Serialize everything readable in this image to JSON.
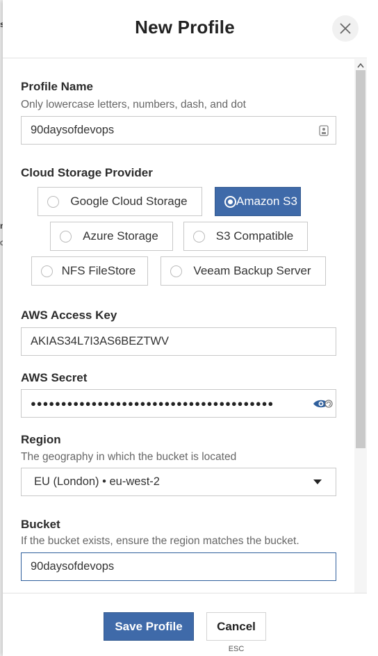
{
  "background_fragments": [
    "s",
    "n",
    "c"
  ],
  "dialog": {
    "title": "New Profile",
    "close_icon": "close-icon"
  },
  "form": {
    "profile_name": {
      "label": "Profile Name",
      "hint": "Only lowercase letters, numbers, dash, and dot",
      "value": "90daysofdevops",
      "icon": "contact-card-icon"
    },
    "provider": {
      "label": "Cloud Storage Provider",
      "options": [
        "Google Cloud Storage",
        "Amazon S3",
        "Azure Storage",
        "S3 Compatible",
        "NFS FileStore",
        "Veeam Backup Server"
      ],
      "selected": "Amazon S3"
    },
    "access_key": {
      "label": "AWS Access Key",
      "value": "AKIAS34L7I3AS6BEZTWV"
    },
    "secret": {
      "label": "AWS Secret",
      "masked_value": "●●●●●●●●●●●●●●●●●●●●●●●●●●●●●●●●●●●●●●●●",
      "icon": "show-password-eye-icon"
    },
    "region": {
      "label": "Region",
      "hint": "The geography in which the bucket is located",
      "selected": "EU (London) • eu-west-2"
    },
    "bucket": {
      "label": "Bucket",
      "hint": "If the bucket exists, ensure the region matches the bucket.",
      "value": "90daysofdevops"
    }
  },
  "footer": {
    "save_label": "Save Profile",
    "cancel_label": "Cancel",
    "cancel_shortcut": "ESC"
  },
  "colors": {
    "primary": "#3f6aa9",
    "focus_border": "#2f5f9c"
  }
}
